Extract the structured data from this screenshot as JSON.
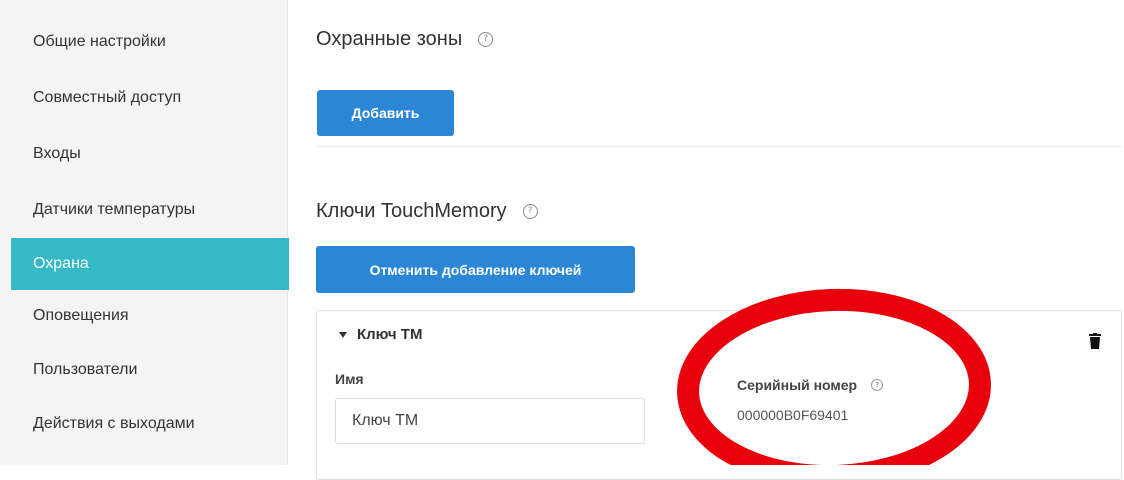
{
  "sidebar": {
    "items": [
      {
        "label": "Общие настройки",
        "active": false
      },
      {
        "label": "Совместный доступ",
        "active": false
      },
      {
        "label": "Входы",
        "active": false
      },
      {
        "label": "Датчики температуры",
        "active": false
      },
      {
        "label": "Охрана",
        "active": true
      },
      {
        "label": "Оповещения",
        "active": false
      },
      {
        "label": "Пользователи",
        "active": false
      },
      {
        "label": "Действия с выходами",
        "active": false
      }
    ]
  },
  "zones": {
    "title": "Охранные зоны",
    "help": "?",
    "add_label": "Добавить"
  },
  "keys": {
    "title": "Ключи TouchMemory",
    "help": "?",
    "cancel_label": "Отменить добавление ключей",
    "card": {
      "header": "Ключ ТМ",
      "name_label": "Имя",
      "name_value": "Ключ ТМ",
      "serial_label": "Серийный номер",
      "serial_help": "?",
      "serial_value": "000000B0F69401"
    }
  },
  "colors": {
    "accent": "#35b9c6",
    "button": "#2b87d6",
    "annotation": "#e8000a"
  },
  "icons": {
    "help": "question-circle-icon",
    "collapse": "caret-down-icon",
    "delete": "trash-icon"
  }
}
